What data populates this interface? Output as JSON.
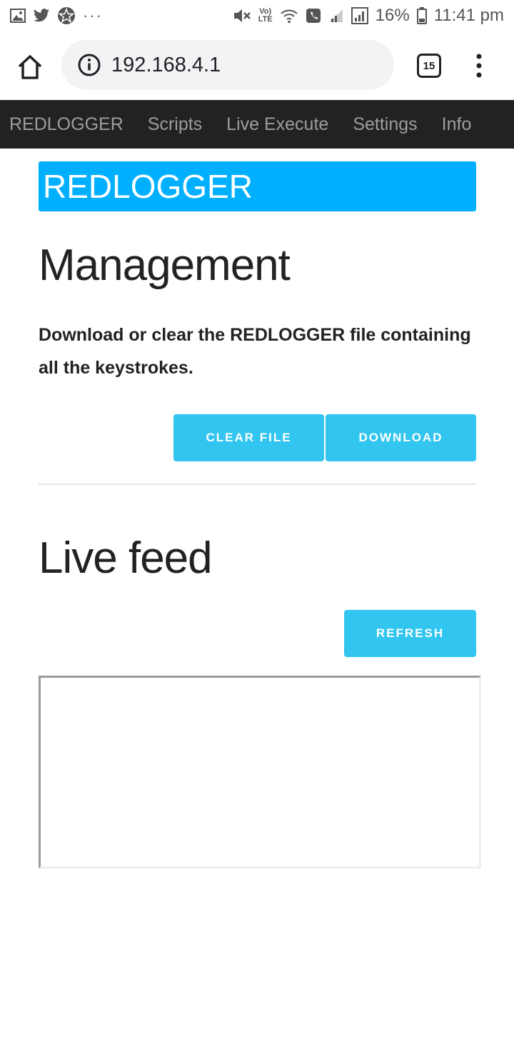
{
  "status_bar": {
    "icons_left": [
      "gallery-icon",
      "twitter-icon",
      "pentagram-icon"
    ],
    "more_dots": "···",
    "lte_label_top": "Vo)",
    "lte_label_bottom": "LTE",
    "battery_percent": "16%",
    "time": "11:41 pm"
  },
  "browser": {
    "url": "192.168.4.1",
    "tab_count": "15"
  },
  "nav": {
    "items": [
      {
        "label": "REDLOGGER"
      },
      {
        "label": "Scripts"
      },
      {
        "label": "Live Execute"
      },
      {
        "label": "Settings"
      },
      {
        "label": "Info"
      }
    ]
  },
  "page": {
    "banner": "REDLOGGER",
    "management": {
      "title": "Management",
      "description": "Download or clear the REDLOGGER file containing all the keystrokes.",
      "clear_button": "CLEAR FILE",
      "download_button": "DOWNLOAD"
    },
    "live_feed": {
      "title": "Live feed",
      "refresh_button": "REFRESH",
      "feed_text": ""
    }
  },
  "colors": {
    "nav_background": "#222222",
    "banner": "#00b0ff",
    "button": "#32c5f0"
  }
}
